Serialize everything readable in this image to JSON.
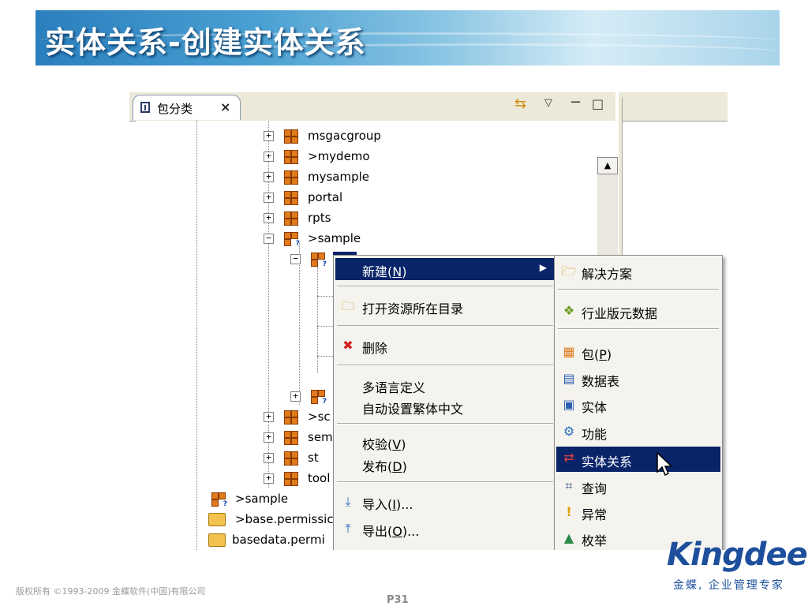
{
  "slide": {
    "title": "实体关系-创建实体关系",
    "copyright": "版权所有 ©1993-2009 金蝶软件(中国)有限公司",
    "page_number": "P31",
    "logo_text": "Kingdee",
    "slogan": "金蝶, 企业管理专家"
  },
  "view": {
    "tab_label": "包分类",
    "tab_close": "×"
  },
  "tree": {
    "items": [
      {
        "label": "msgacgroup"
      },
      {
        "label": ">mydemo"
      },
      {
        "label": "mysample"
      },
      {
        "label": "portal"
      },
      {
        "label": "rpts"
      },
      {
        "label": ">sample"
      },
      {
        "label": ">sc"
      },
      {
        "label": "sem"
      },
      {
        "label": "st"
      },
      {
        "label": "tool"
      },
      {
        "label": ">sample"
      },
      {
        "label": ">base.permissic"
      },
      {
        "label": "basedata.permi"
      }
    ]
  },
  "context_menu": {
    "new": {
      "label": "新建(",
      "mnemonic": "N",
      "tail": ")"
    },
    "open_dir": {
      "label": "打开资源所在目录"
    },
    "delete": {
      "label": "删除"
    },
    "multilang": {
      "label": "多语言定义"
    },
    "auto_trad": {
      "label": "自动设置繁体中文"
    },
    "verify": {
      "label": "校验(",
      "mnemonic": "V",
      "tail": ")"
    },
    "publish": {
      "label": "发布(",
      "mnemonic": "D",
      "tail": ")"
    },
    "import": {
      "label": "导入(",
      "mnemonic": "I",
      "tail": ")..."
    },
    "export": {
      "label": "导出(",
      "mnemonic": "O",
      "tail": ")..."
    }
  },
  "submenu": {
    "solution": {
      "label": "解决方案"
    },
    "industry": {
      "label": "行业版元数据"
    },
    "package": {
      "label": "包(",
      "mnemonic": "P",
      "tail": ")"
    },
    "table": {
      "label": "数据表"
    },
    "entity": {
      "label": "实体"
    },
    "function": {
      "label": "功能"
    },
    "relation": {
      "label": "实体关系"
    },
    "query": {
      "label": "查询"
    },
    "exception": {
      "label": "异常"
    },
    "enum": {
      "label": "枚举"
    }
  },
  "colors": {
    "highlight": "#0a246a",
    "menu_bg": "#f4f3ee",
    "brand_blue": "#1d4f9c"
  }
}
